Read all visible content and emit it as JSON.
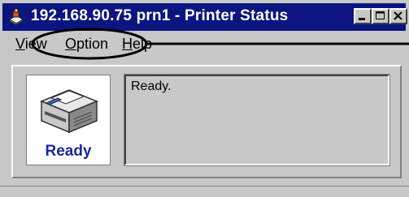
{
  "window": {
    "title": "192.168.90.75 prn1 - Printer Status",
    "app_icon": "printer-app-icon",
    "controls": [
      "minimize",
      "maximize",
      "close"
    ],
    "title_bar_color": "#0a1580"
  },
  "menu": {
    "items": [
      {
        "label": "View",
        "underline": "V",
        "rest": "iew"
      },
      {
        "label": "Option",
        "underline": "O",
        "rest": "ption"
      },
      {
        "label": "Help",
        "underline": "H",
        "rest": "elp"
      }
    ],
    "highlight": "ellipse-around-option-and-help"
  },
  "printer": {
    "icon": "printer-icon",
    "state_label": "Ready",
    "state_color": "#1a2a9a"
  },
  "status": {
    "message": "Ready."
  }
}
